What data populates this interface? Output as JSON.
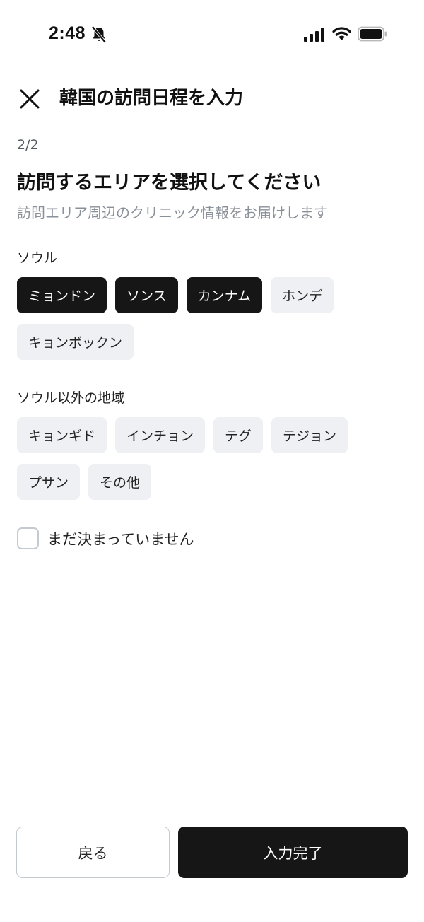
{
  "status_bar": {
    "time": "2:48",
    "icons": [
      "bell-slash-icon",
      "cellular-signal-icon",
      "wifi-icon",
      "battery-icon"
    ]
  },
  "header": {
    "close_icon": "close-icon",
    "title": "韓国の訪問日程を入力"
  },
  "step": "2/2",
  "question": "訪問するエリアを選択してください",
  "subtitle": "訪問エリア周辺のクリニック情報をお届けします",
  "seoul": {
    "label": "ソウル",
    "options": [
      {
        "label": "ミョンドン",
        "selected": true
      },
      {
        "label": "ソンス",
        "selected": true
      },
      {
        "label": "カンナム",
        "selected": true
      },
      {
        "label": "ホンデ",
        "selected": false
      },
      {
        "label": "キョンボックン",
        "selected": false
      }
    ]
  },
  "outside": {
    "label": "ソウル以外の地域",
    "options": [
      {
        "label": "キョンギド",
        "selected": false
      },
      {
        "label": "インチョン",
        "selected": false
      },
      {
        "label": "テグ",
        "selected": false
      },
      {
        "label": "テジョン",
        "selected": false
      },
      {
        "label": "プサン",
        "selected": false
      },
      {
        "label": "その他",
        "selected": false
      }
    ]
  },
  "undecided": {
    "label": "まだ決まっていません",
    "checked": false
  },
  "footer": {
    "back_label": "戻る",
    "done_label": "入力完了"
  },
  "colors": {
    "selected_chip": "#161616",
    "unselected_chip": "#eef0f3",
    "subtitle_text": "#8a9099"
  }
}
